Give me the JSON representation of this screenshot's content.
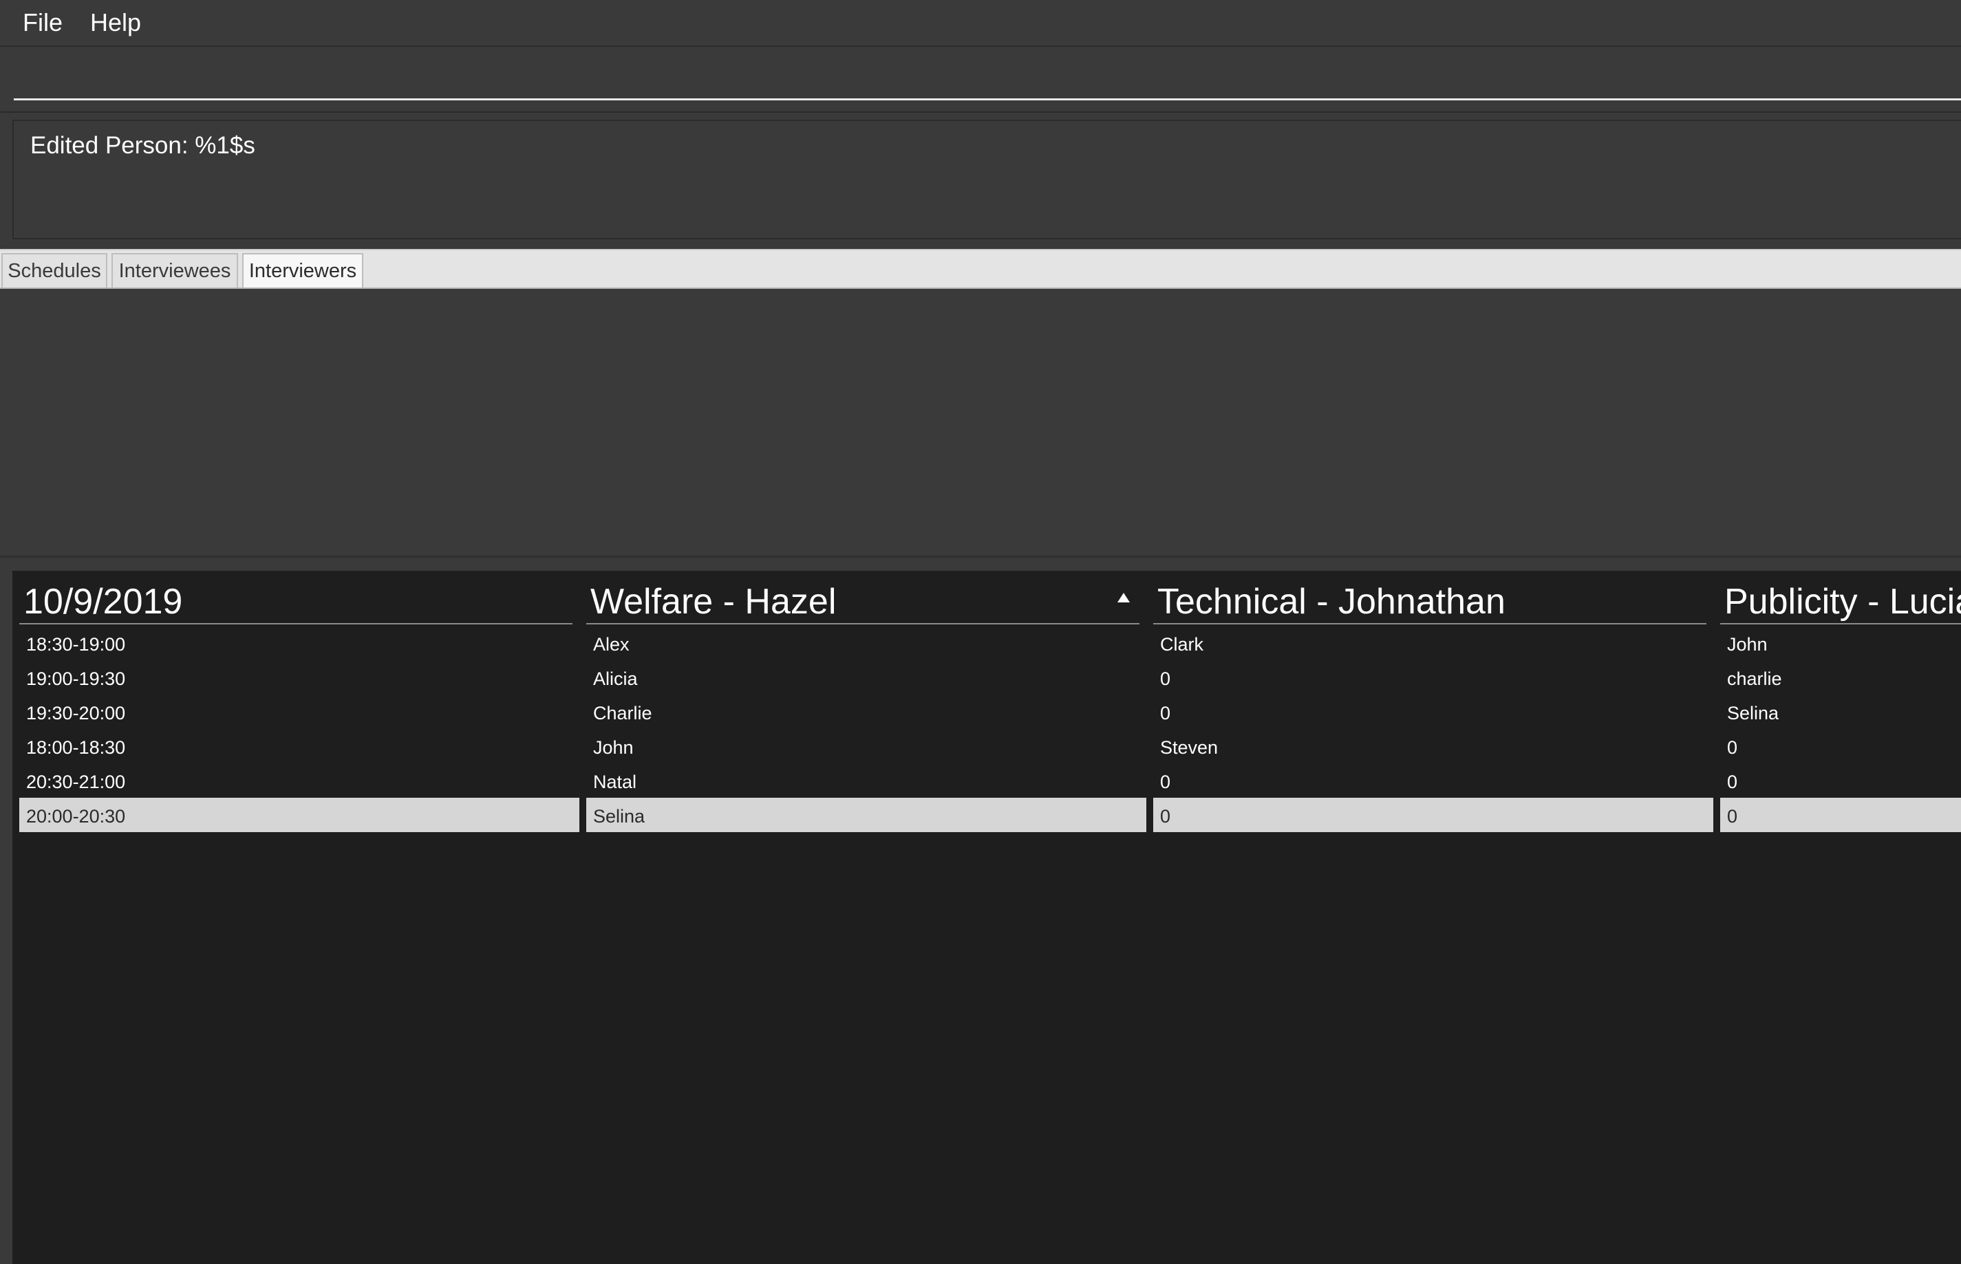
{
  "menu": {
    "file": "File",
    "help": "Help"
  },
  "command_box": {
    "value": ""
  },
  "result_display": {
    "text": "Edited Person: %1$s"
  },
  "tabs": [
    {
      "label": "Schedules",
      "active": false
    },
    {
      "label": "Interviewees",
      "active": false
    },
    {
      "label": "Interviewers",
      "active": true
    }
  ],
  "schedule_table": {
    "columns": [
      "10/9/2019",
      "Welfare - Hazel",
      "Technical - Johnathan",
      "Publicity - Lucia"
    ],
    "sorted_column": "Welfare - Hazel",
    "sort_direction": "ascending",
    "rows": [
      [
        "18:30-19:00",
        "Alex",
        "Clark",
        "John"
      ],
      [
        "19:00-19:30",
        "Alicia",
        "0",
        "charlie"
      ],
      [
        "19:30-20:00",
        "Charlie",
        "0",
        "Selina"
      ],
      [
        "18:00-18:30",
        "John",
        "Steven",
        "0"
      ],
      [
        "20:30-21:00",
        "Natal",
        "0",
        "0"
      ],
      [
        "20:00-20:30",
        "Selina",
        "0",
        "0"
      ]
    ],
    "selected_row": 5
  }
}
